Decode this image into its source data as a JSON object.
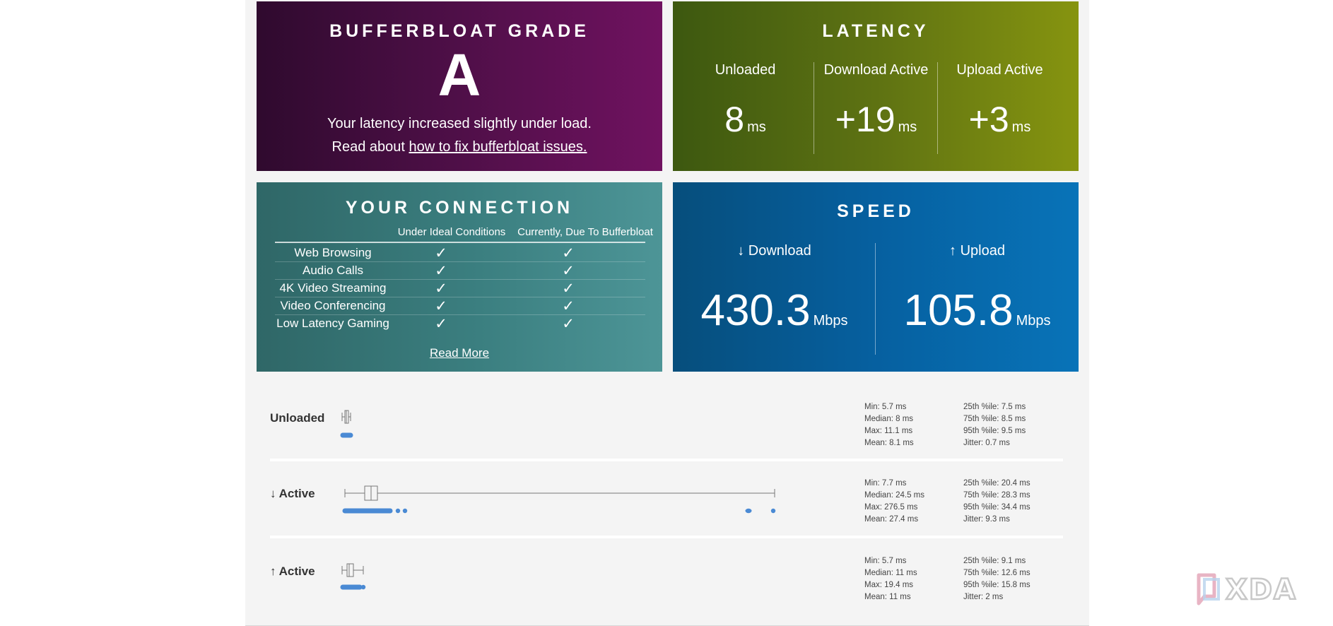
{
  "grade": {
    "title": "BUFFERBLOAT GRADE",
    "letter": "A",
    "line1": "Your latency increased slightly under load.",
    "line2_prefix": "Read about ",
    "line2_link": "how to fix bufferbloat issues."
  },
  "latency": {
    "title": "LATENCY",
    "columns": [
      {
        "label": "Unloaded",
        "value": "8",
        "unit": "ms"
      },
      {
        "label": "Download Active",
        "value": "+19",
        "unit": "ms"
      },
      {
        "label": "Upload Active",
        "value": "+3",
        "unit": "ms"
      }
    ]
  },
  "connection": {
    "title": "YOUR CONNECTION",
    "col_ideal": "Under Ideal Conditions",
    "col_current": "Currently, Due To Bufferbloat",
    "check_glyph": "✓",
    "rows": [
      {
        "name": "Web Browsing"
      },
      {
        "name": "Audio Calls"
      },
      {
        "name": "4K Video Streaming"
      },
      {
        "name": "Video Conferencing"
      },
      {
        "name": "Low Latency Gaming"
      }
    ],
    "read_more": "Read More"
  },
  "speed": {
    "title": "SPEED",
    "download": {
      "label": "↓ Download",
      "value": "430.3",
      "unit": "Mbps"
    },
    "upload": {
      "label": "↑ Upload",
      "value": "105.8",
      "unit": "Mbps"
    }
  },
  "distribution": {
    "accent": "#4a8ad4",
    "rows": [
      {
        "label": "Unloaded",
        "stats_left": [
          "Min: 5.7 ms",
          "Median: 8 ms",
          "Max: 11.1 ms",
          "Mean: 8.1 ms"
        ],
        "stats_right": [
          "25th %ile: 7.5 ms",
          "75th %ile: 8.5 ms",
          "95th %ile: 9.5 ms",
          "Jitter: 0.7 ms"
        ]
      },
      {
        "label": "↓ Active",
        "stats_left": [
          "Min: 7.7 ms",
          "Median: 24.5 ms",
          "Max: 276.5 ms",
          "Mean: 27.4 ms"
        ],
        "stats_right": [
          "25th %ile: 20.4 ms",
          "75th %ile: 28.3 ms",
          "95th %ile: 34.4 ms",
          "Jitter: 9.3 ms"
        ]
      },
      {
        "label": "↑ Active",
        "stats_left": [
          "Min: 5.7 ms",
          "Median: 11 ms",
          "Max: 19.4 ms",
          "Mean: 11 ms"
        ],
        "stats_right": [
          "25th %ile: 9.1 ms",
          "75th %ile: 12.6 ms",
          "95th %ile: 15.8 ms",
          "Jitter: 2 ms"
        ]
      }
    ]
  },
  "watermark": {
    "text": "XDA"
  }
}
